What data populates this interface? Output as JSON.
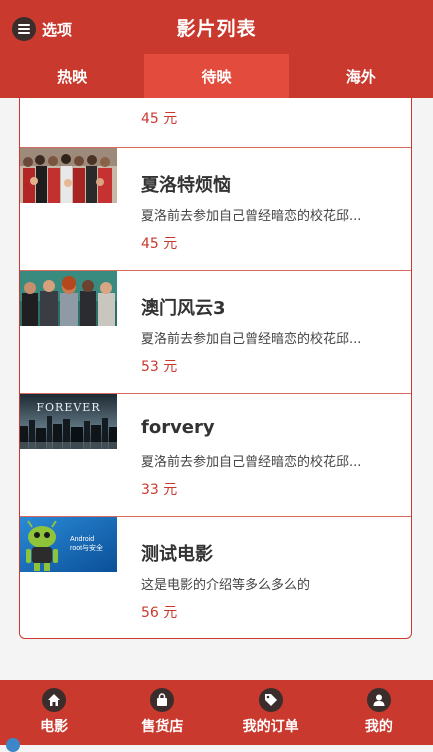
{
  "header": {
    "menu_label": "选项",
    "title": "影片列表"
  },
  "tabs": [
    {
      "label": "热映",
      "active": false
    },
    {
      "label": "待映",
      "active": true
    },
    {
      "label": "海外",
      "active": false
    }
  ],
  "partial_item": {
    "price": "45 元"
  },
  "movies": [
    {
      "title": "夏洛特烦恼",
      "desc": "夏洛前去参加自己曾经暗恋的校花邱...",
      "price": "45 元",
      "thumb": "group-photo-thumbnail"
    },
    {
      "title": "澳门风云3",
      "desc": "夏洛前去参加自己曾经暗恋的校花邱...",
      "price": "53 元",
      "thumb": "cast-photo-thumbnail"
    },
    {
      "title": "forvery",
      "desc": "夏洛前去参加自己曾经暗恋的校花邱...",
      "price": "33 元",
      "thumb": "forever-city-thumbnail"
    },
    {
      "title": "测试电影",
      "desc": "这是电影的介绍等多么多么的",
      "price": "56 元",
      "thumb": "android-robot-thumbnail"
    }
  ],
  "bottom_nav": [
    {
      "label": "电影",
      "icon": "home-icon"
    },
    {
      "label": "售货店",
      "icon": "bag-icon"
    },
    {
      "label": "我的订单",
      "icon": "tag-icon"
    },
    {
      "label": "我的",
      "icon": "user-icon"
    }
  ],
  "thumb_texts": {
    "forever": "FOREVER",
    "android_line1": "Android",
    "android_line2": "root与安全"
  },
  "colors": {
    "brand_red": "#c9392e",
    "active_tab": "#e34c3d",
    "price_red": "#c9392e"
  }
}
